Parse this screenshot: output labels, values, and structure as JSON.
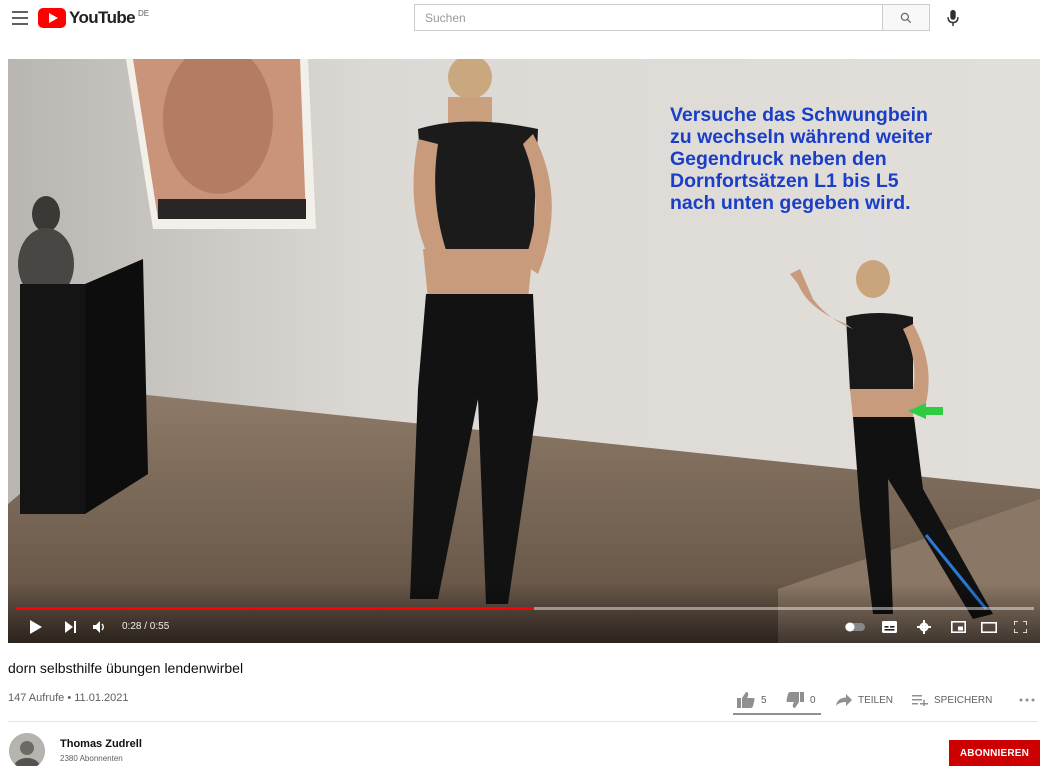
{
  "header": {
    "logo_text": "YouTube",
    "country_code": "DE",
    "search_placeholder": "Suchen"
  },
  "player": {
    "overlay_text": "Versuche das Schwungbein\nzu wechseln während weiter\nGegendruck neben den\nDornfortsätzen L1 bis L5\nnach unten gegeben wird.",
    "time": "0:28 / 0:55",
    "progress_fraction": 0.509,
    "colors": {
      "progress": "#ff0000",
      "overlay_text": "#1a3ec8"
    }
  },
  "video": {
    "title": "dorn selbsthilfe übungen lendenwirbel",
    "meta": "147 Aufrufe • 11.01.2021"
  },
  "actions": {
    "like_count": "5",
    "dislike_count": "0",
    "share_label": "TEILEN",
    "save_label": "SPEICHERN"
  },
  "channel": {
    "name": "Thomas Zudrell",
    "subscribers": "2380 Abonnenten",
    "subscribe_label": "ABONNIEREN",
    "subscribe_color": "#cc0000"
  },
  "icons": [
    "menu-icon",
    "youtube-logo-icon",
    "search-icon",
    "mic-icon",
    "play-icon",
    "next-icon",
    "volume-icon",
    "autoplay-toggle-icon",
    "subtitles-icon",
    "settings-icon",
    "miniplayer-icon",
    "theater-mode-icon",
    "fullscreen-icon",
    "thumbs-up-icon",
    "thumbs-down-icon",
    "share-icon",
    "save-icon",
    "more-icon"
  ]
}
